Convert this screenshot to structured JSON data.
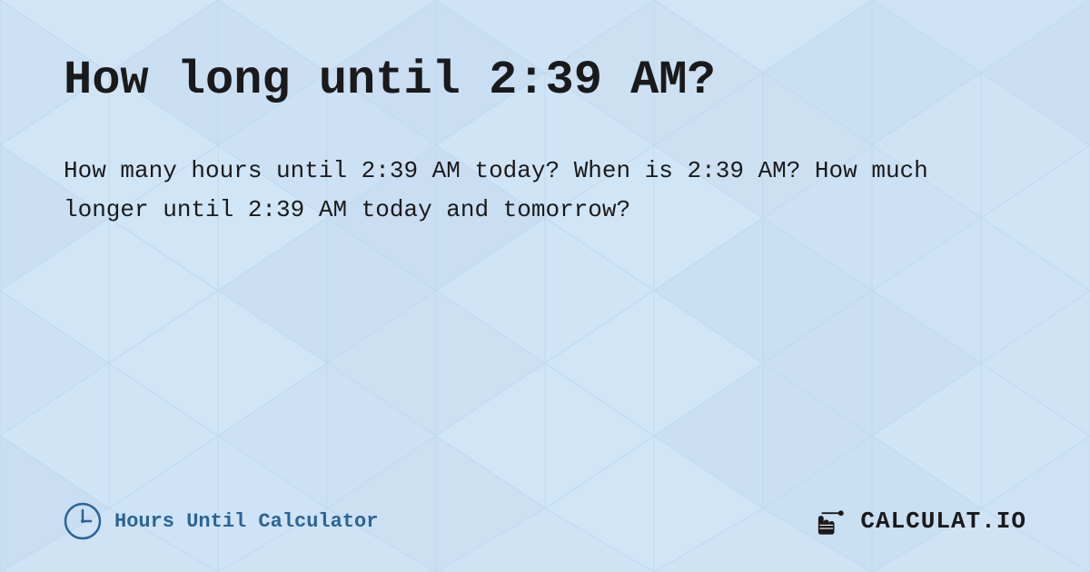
{
  "page": {
    "title": "How long until 2:39 AM?",
    "description": "How many hours until 2:39 AM today? When is 2:39 AM? How much longer until 2:39 AM today and tomorrow?",
    "background_color": "#cfe3f5",
    "footer": {
      "left_label": "Hours Until Calculator",
      "right_label": "CALCULAT.IO"
    }
  }
}
